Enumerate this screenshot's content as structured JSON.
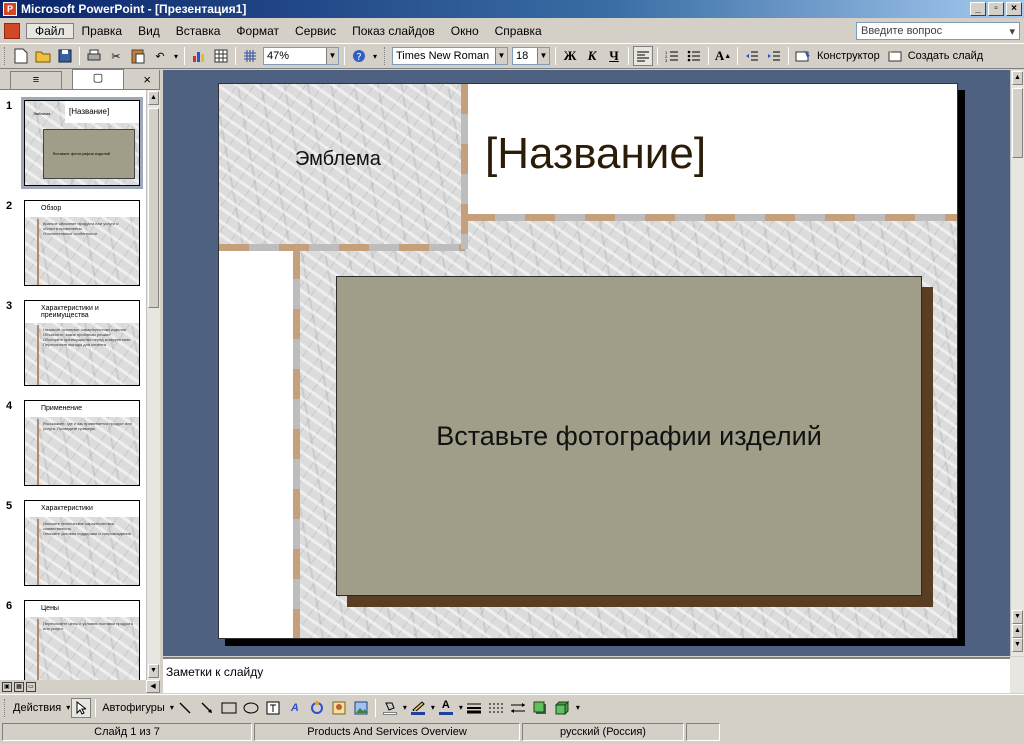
{
  "window": {
    "title": "Microsoft PowerPoint - [Презентация1]",
    "app_icon_glyph": "P",
    "minimize": "_",
    "restore": "▫",
    "close": "×"
  },
  "menu": {
    "items": [
      "Файл",
      "Правка",
      "Вид",
      "Вставка",
      "Формат",
      "Сервис",
      "Показ слайдов",
      "Окно",
      "Справка"
    ],
    "help_placeholder": "Введите вопрос"
  },
  "toolbar": {
    "zoom": "47%",
    "font_name": "Times New Roman",
    "font_size": "18",
    "bold": "Ж",
    "italic": "К",
    "underline": "Ч",
    "designer": "Конструктор",
    "new_slide": "Создать слайд"
  },
  "left_panel": {
    "tab_outline_icon": "≡",
    "tab_slides_icon": "▢",
    "close": "×",
    "slides": [
      {
        "num": "1",
        "title": "[Название]",
        "logo": "Эмблема",
        "caption": "Вставьте фотографии изделий",
        "lines": []
      },
      {
        "num": "2",
        "title": "Обзор",
        "caption": "",
        "lines": [
          "Краткое описание продукта или услуги и области применения",
          "Отличительные особенности"
        ]
      },
      {
        "num": "3",
        "title": "Характеристики и преимущества",
        "caption": "",
        "lines": [
          "Назовите основные характеристики изделия",
          "Объясните, какие проблемы решает",
          "Обоснуйте преимущества перед конкурентами",
          "Перечислите выгоды для клиента"
        ]
      },
      {
        "num": "4",
        "title": "Применение",
        "caption": "",
        "lines": [
          "Расскажите, где и как применяется продукт или услуга. Приведите примеры."
        ]
      },
      {
        "num": "5",
        "title": "Характеристики",
        "caption": "",
        "lines": [
          "Опишите технические характеристики, совместимость",
          "Опишите условия поддержки и сопровождения"
        ]
      },
      {
        "num": "6",
        "title": "Цены",
        "caption": "",
        "lines": [
          "Перечислите цены и условия поставки продукта или услуги"
        ]
      }
    ]
  },
  "slide": {
    "logo_text": "Эмблема",
    "title_placeholder": "[Название]",
    "photo_placeholder": "Вставьте фотографии изделий"
  },
  "notes": {
    "placeholder": "Заметки к слайду"
  },
  "drawing_toolbar": {
    "actions": "Действия",
    "autoshapes": "Автофигуры"
  },
  "status": {
    "slide_counter": "Слайд 1 из 7",
    "design_name": "Products And Services Overview",
    "language": "русский (Россия)"
  },
  "colors": {
    "workarea": "#4f6180",
    "photo_box": "#a09e88",
    "photo_shadow": "#5a3e23",
    "title_text": "#2b1c08",
    "dash_tan": "#c4a07c",
    "dash_grey": "#bdbdbd"
  }
}
